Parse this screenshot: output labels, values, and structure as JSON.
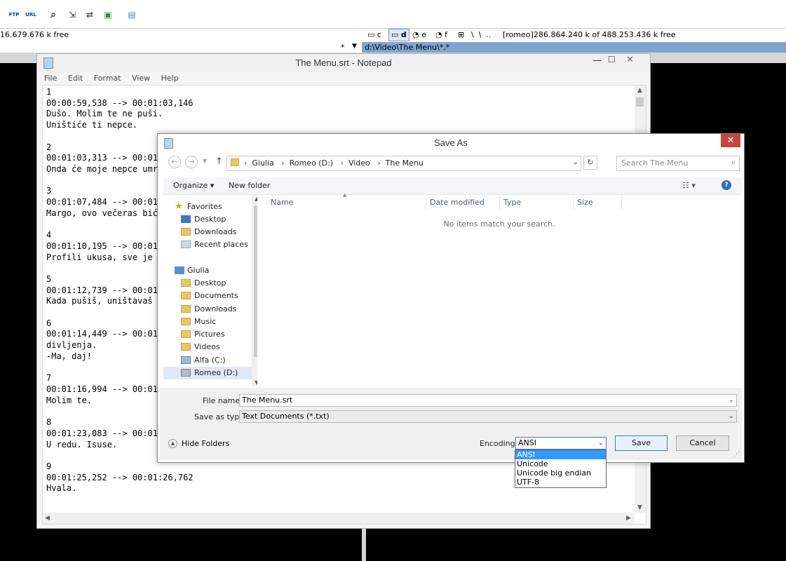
{
  "tc": {
    "left_free": "16.679.676 k free",
    "drives": [
      "c",
      "d",
      "e",
      "f"
    ],
    "root_symbols": "\\  \\  ..",
    "volume": "[romeo]",
    "right_free": "286.864.240 k of 488.253.436 k free",
    "path_star": "*",
    "path_arrow": "▼",
    "path": "d:\\Video\\The Menu\\*.*"
  },
  "notepad": {
    "title": "The Menu.srt - Notepad",
    "menu": [
      "File",
      "Edit",
      "Format",
      "View",
      "Help"
    ],
    "lines": [
      "1",
      "00:00:59,538 --> 00:01:03,146",
      "Dušo. Molim te ne puši.",
      "Uništiće ti nepce.",
      "",
      "2",
      "00:01:03,313 --> 00:01:",
      "Onda će moje nepce umre",
      "",
      "3",
      "00:01:07,484 --> 00:01:",
      "Margo, ovo večeras biće",
      "",
      "4",
      "00:01:10,195 --> 00:01:",
      "Profili ukusa, sve je s",
      "",
      "5",
      "00:01:12,739 --> 00:01:",
      "Kada pušiš, uništavaš s",
      "",
      "6",
      "00:01:14,449 --> 00:01:",
      "divljenja.",
      "-Ma, daj!",
      "",
      "7",
      "00:01:16,994 --> 00:01:",
      "Molim te.",
      "",
      "8",
      "00:01:23,083 --> 00:01:",
      "U redu. Isuse.",
      "",
      "9",
      "00:01:25,252 --> 00:01:26,762",
      "Hvala."
    ]
  },
  "dialog": {
    "title": "Save As",
    "close": "✕",
    "breadcrumbs": [
      "Giulia",
      "Romeo (D:)",
      "Video",
      "The Menu"
    ],
    "search_placeholder": "Search The Menu",
    "organize": "Organize ▾",
    "new_folder": "New folder",
    "nav": {
      "favorites": "Favorites",
      "fav_items": [
        "Desktop",
        "Downloads",
        "Recent places"
      ],
      "user": "Giulia",
      "user_items": [
        "Desktop",
        "Documents",
        "Downloads",
        "Music",
        "Pictures",
        "Videos",
        "Alfa (C:)",
        "Romeo (D:)"
      ]
    },
    "columns": [
      "Name",
      "Date modified",
      "Type",
      "Size"
    ],
    "empty": "No items match your search.",
    "file_name_label": "File name:",
    "file_name": "The Menu.srt",
    "save_type_label": "Save as type:",
    "save_type": "Text Documents (*.txt)",
    "hide_folders": "Hide Folders",
    "encoding_label": "Encoding:",
    "encoding": "ANSI",
    "encoding_options": [
      "ANSI",
      "Unicode",
      "Unicode big endian",
      "UTF-8"
    ],
    "save": "Save",
    "cancel": "Cancel"
  }
}
